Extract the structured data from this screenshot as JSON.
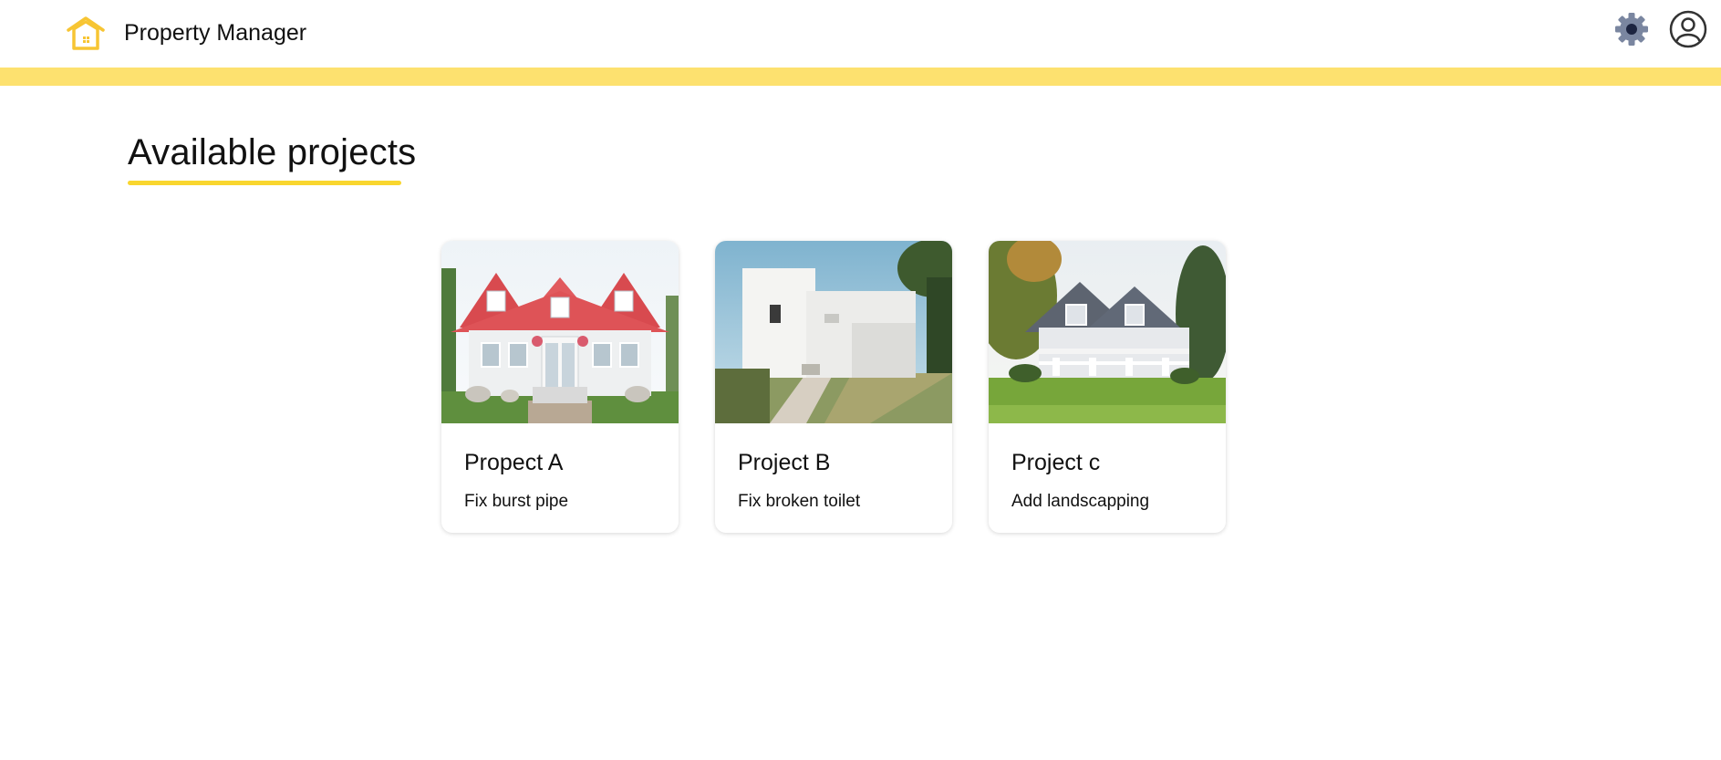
{
  "app": {
    "title": "Property Manager",
    "logo_icon": "house-icon",
    "accent_color": "#fde16f",
    "brand_color": "#f7c533"
  },
  "header": {
    "settings_icon": "gear-icon",
    "profile_icon": "user-circle-icon"
  },
  "main": {
    "title": "Available projects",
    "underline_color": "#f9d62e"
  },
  "projects": [
    {
      "title": "Propect A",
      "description": "Fix burst pipe",
      "image": "white-house-red-roof"
    },
    {
      "title": "Project B",
      "description": "Fix broken toilet",
      "image": "modern-white-house"
    },
    {
      "title": "Project c",
      "description": "Add landscapping",
      "image": "house-with-porch-lawn"
    }
  ]
}
